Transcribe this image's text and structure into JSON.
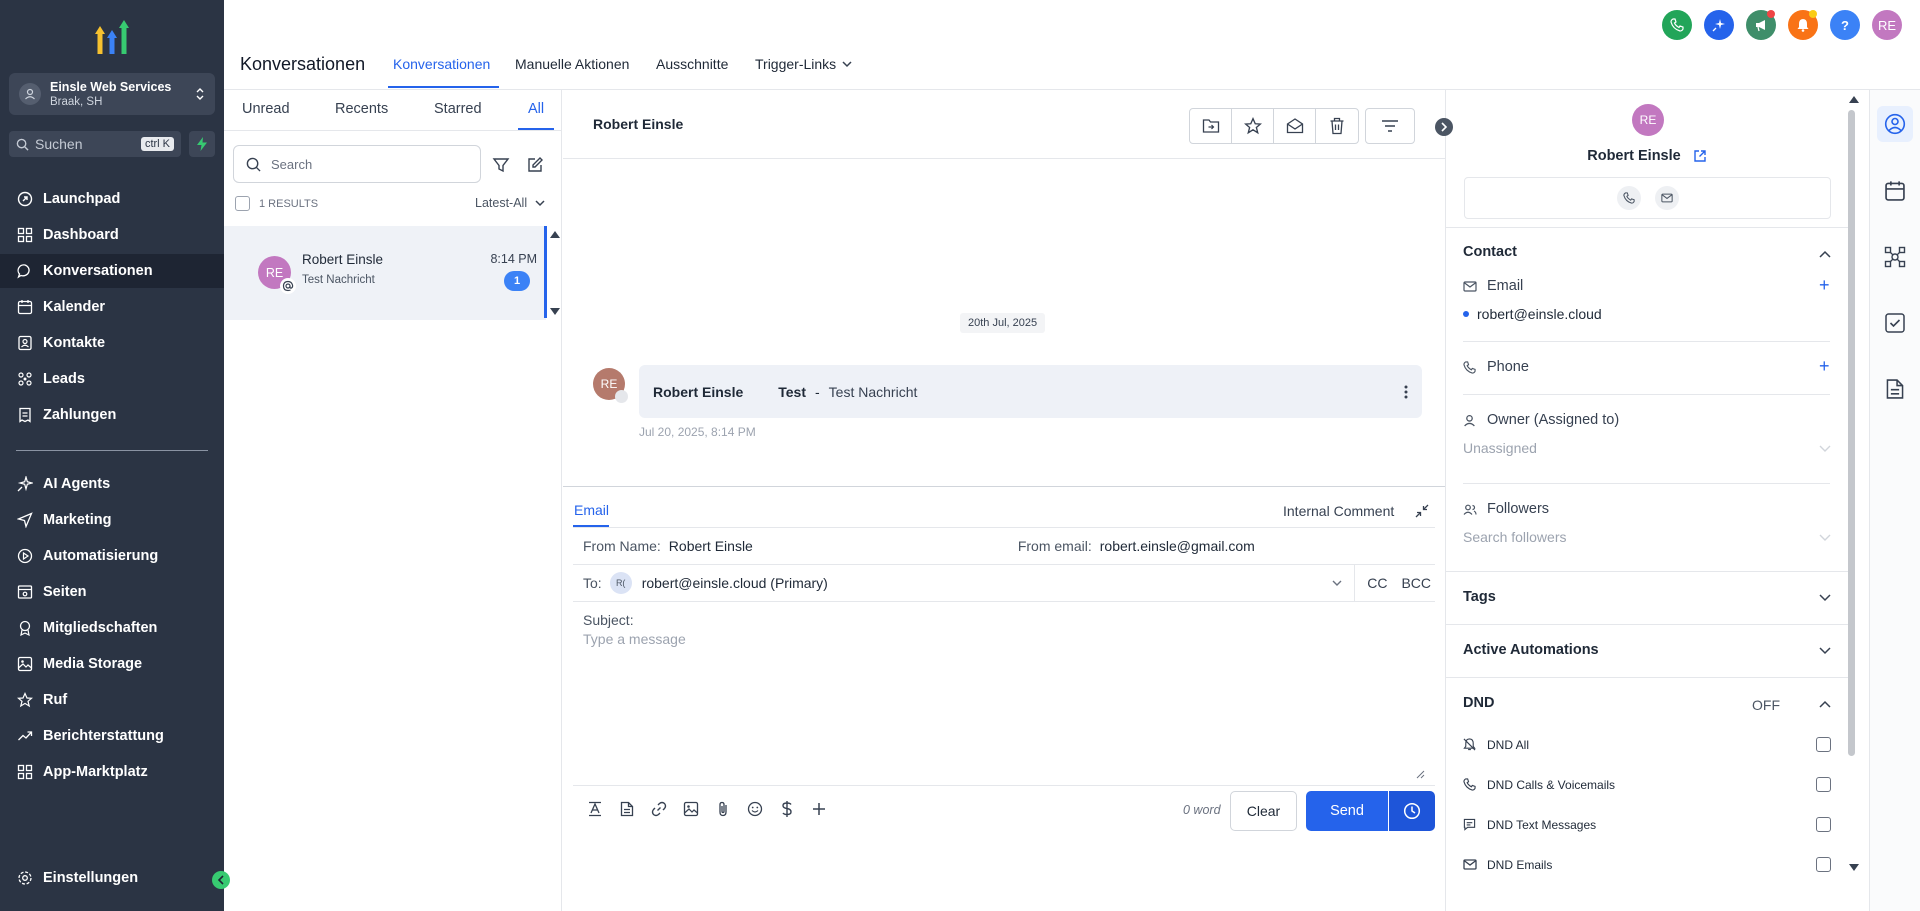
{
  "sidebar": {
    "account_name": "Einsle Web Services",
    "account_location": "Braak, SH",
    "search_placeholder": "Suchen",
    "search_shortcut": "ctrl K",
    "items": [
      {
        "label": "Launchpad",
        "icon": "rocket-icon"
      },
      {
        "label": "Dashboard",
        "icon": "grid-icon"
      },
      {
        "label": "Konversationen",
        "icon": "chat-bubble-icon"
      },
      {
        "label": "Kalender",
        "icon": "calendar-icon"
      },
      {
        "label": "Kontakte",
        "icon": "contacts-icon"
      },
      {
        "label": "Leads",
        "icon": "leads-icon"
      },
      {
        "label": "Zahlungen",
        "icon": "receipt-icon"
      },
      {
        "label": "AI Agents",
        "icon": "sparkle-icon"
      },
      {
        "label": "Marketing",
        "icon": "send-icon"
      },
      {
        "label": "Automatisierung",
        "icon": "automation-icon"
      },
      {
        "label": "Seiten",
        "icon": "pages-icon"
      },
      {
        "label": "Mitgliedschaften",
        "icon": "badge-icon"
      },
      {
        "label": "Media Storage",
        "icon": "image-icon"
      },
      {
        "label": "Ruf",
        "icon": "star-icon"
      },
      {
        "label": "Berichterstattung",
        "icon": "trend-icon"
      },
      {
        "label": "App-Marktplatz",
        "icon": "apps-icon"
      }
    ],
    "settings_label": "Einstellungen"
  },
  "header": {
    "title": "Konversationen",
    "tabs": [
      "Konversationen",
      "Manuelle Aktionen",
      "Ausschnitte",
      "Trigger-Links"
    ],
    "user_initials": "RE",
    "help_glyph": "?"
  },
  "list": {
    "tabs": [
      "Unread",
      "Recents",
      "Starred",
      "All"
    ],
    "search_placeholder": "Search",
    "results": "1 RESULTS",
    "sort": "Latest-All",
    "conversation": {
      "initials": "RE",
      "name": "Robert Einsle",
      "preview": "Test Nachricht",
      "time": "8:14 PM",
      "unread": "1"
    }
  },
  "thread": {
    "title": "Robert Einsle",
    "date_chip": "20th Jul, 2025",
    "message": {
      "initials": "RE",
      "sender": "Robert Einsle",
      "subject": "Test",
      "separator": "-",
      "body": "Test Nachricht",
      "timestamp": "Jul 20, 2025, 8:14 PM"
    }
  },
  "composer": {
    "tab_email": "Email",
    "tab_internal": "Internal Comment",
    "from_name_label": "From Name:",
    "from_name": "Robert Einsle",
    "from_email_label": "From email:",
    "from_email": "robert.einsle@gmail.com",
    "to_label": "To:",
    "to_chip": "R(",
    "to_value": "robert@einsle.cloud (Primary)",
    "cc": "CC",
    "bcc": "BCC",
    "subject_label": "Subject:",
    "message_placeholder": "Type a message",
    "word_count": "0 word",
    "clear": "Clear",
    "send": "Send"
  },
  "contact_panel": {
    "initials": "RE",
    "name": "Robert Einsle",
    "contact_section": "Contact",
    "email_label": "Email",
    "email_value": "robert@einsle.cloud",
    "phone_label": "Phone",
    "owner_label": "Owner (Assigned to)",
    "owner_value": "Unassigned",
    "followers_label": "Followers",
    "followers_placeholder": "Search followers",
    "tags": "Tags",
    "active_automations": "Active Automations",
    "dnd": "DND",
    "dnd_state": "OFF",
    "dnd_options": [
      "DND All",
      "DND Calls & Voicemails",
      "DND Text Messages",
      "DND Emails"
    ]
  },
  "colors": {
    "sidebar_bg": "#2b3444",
    "accent": "#2563eb",
    "avatar_purple": "#c278c0"
  }
}
